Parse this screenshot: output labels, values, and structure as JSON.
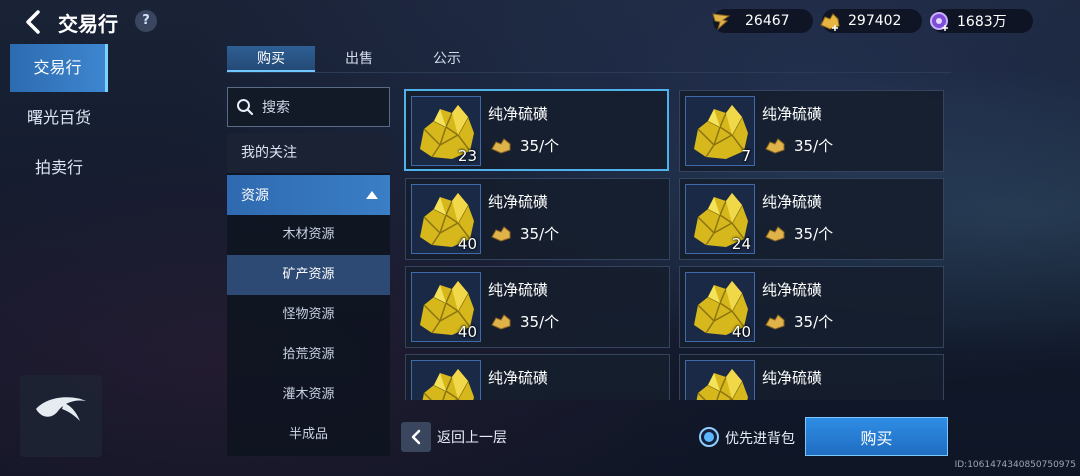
{
  "header": {
    "title": "交易行",
    "help": "?",
    "currencies": [
      {
        "name": "feather-currency-icon",
        "value": "26467"
      },
      {
        "name": "gold-ore-currency-icon",
        "value": "297402"
      },
      {
        "name": "purple-orb-currency-icon",
        "value": "1683万"
      }
    ]
  },
  "leftnav": {
    "items": [
      {
        "label": "交易行",
        "active": true
      },
      {
        "label": "曙光百货",
        "active": false
      },
      {
        "label": "拍卖行",
        "active": false
      }
    ],
    "logo_text": "REPUBLIC OF GAMERS"
  },
  "tabs": [
    {
      "label": "购买",
      "active": true
    },
    {
      "label": "出售",
      "active": false
    },
    {
      "label": "公示",
      "active": false
    }
  ],
  "search": {
    "placeholder": "搜索"
  },
  "categories": {
    "favorites": "我的关注",
    "resources": "资源",
    "sub": [
      {
        "label": "木材资源",
        "active": false
      },
      {
        "label": "矿产资源",
        "active": true
      },
      {
        "label": "怪物资源",
        "active": false
      },
      {
        "label": "拾荒资源",
        "active": false
      },
      {
        "label": "灌木资源",
        "active": false
      },
      {
        "label": "半成品",
        "active": false
      }
    ]
  },
  "items": [
    {
      "name": "纯净硫磺",
      "qty": "23",
      "price": "35/个",
      "selected": true
    },
    {
      "name": "纯净硫磺",
      "qty": "7",
      "price": "35/个",
      "selected": false
    },
    {
      "name": "纯净硫磺",
      "qty": "40",
      "price": "35/个",
      "selected": false
    },
    {
      "name": "纯净硫磺",
      "qty": "24",
      "price": "35/个",
      "selected": false
    },
    {
      "name": "纯净硫磺",
      "qty": "40",
      "price": "35/个",
      "selected": false
    },
    {
      "name": "纯净硫磺",
      "qty": "40",
      "price": "35/个",
      "selected": false
    },
    {
      "name": "纯净硫磺",
      "qty": "",
      "price": "",
      "selected": false
    },
    {
      "name": "纯净硫磺",
      "qty": "",
      "price": "",
      "selected": false
    }
  ],
  "bottom": {
    "back_label": "返回上一层",
    "priority_label": "优先进背包",
    "buy_label": "购买"
  },
  "id_text": "ID:1061474340850750975"
}
